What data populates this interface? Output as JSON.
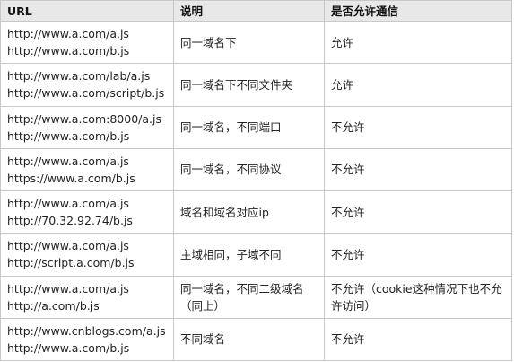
{
  "table": {
    "headers": [
      "URL",
      "说明",
      "是否允许通信"
    ],
    "rows": [
      {
        "url1": "http://www.a.com/a.js",
        "url2": "http://www.a.com/b.js",
        "desc": "同一域名下",
        "allowed": "允许"
      },
      {
        "url1": "http://www.a.com/lab/a.js",
        "url2": "http://www.a.com/script/b.js",
        "desc": "同一域名下不同文件夹",
        "allowed": "允许"
      },
      {
        "url1": "http://www.a.com:8000/a.js",
        "url2": "http://www.a.com/b.js",
        "desc": "同一域名，不同端口",
        "allowed": "不允许"
      },
      {
        "url1": "http://www.a.com/a.js",
        "url2": "https://www.a.com/b.js",
        "desc": "同一域名，不同协议",
        "allowed": "不允许"
      },
      {
        "url1": "http://www.a.com/a.js",
        "url2": "http://70.32.92.74/b.js",
        "desc": "域名和域名对应ip",
        "allowed": "不允许"
      },
      {
        "url1": "http://www.a.com/a.js",
        "url2": "http://script.a.com/b.js",
        "desc": "主域相同，子域不同",
        "allowed": "不允许"
      },
      {
        "url1": "http://www.a.com/a.js",
        "url2": "http://a.com/b.js",
        "desc": "同一域名，不同二级域名（同上）",
        "allowed": "不允许（cookie这种情况下也不允许访问）"
      },
      {
        "url1": "http://www.cnblogs.com/a.js",
        "url2": "http://www.a.com/b.js",
        "desc": "不同域名",
        "allowed": "不允许"
      }
    ]
  }
}
